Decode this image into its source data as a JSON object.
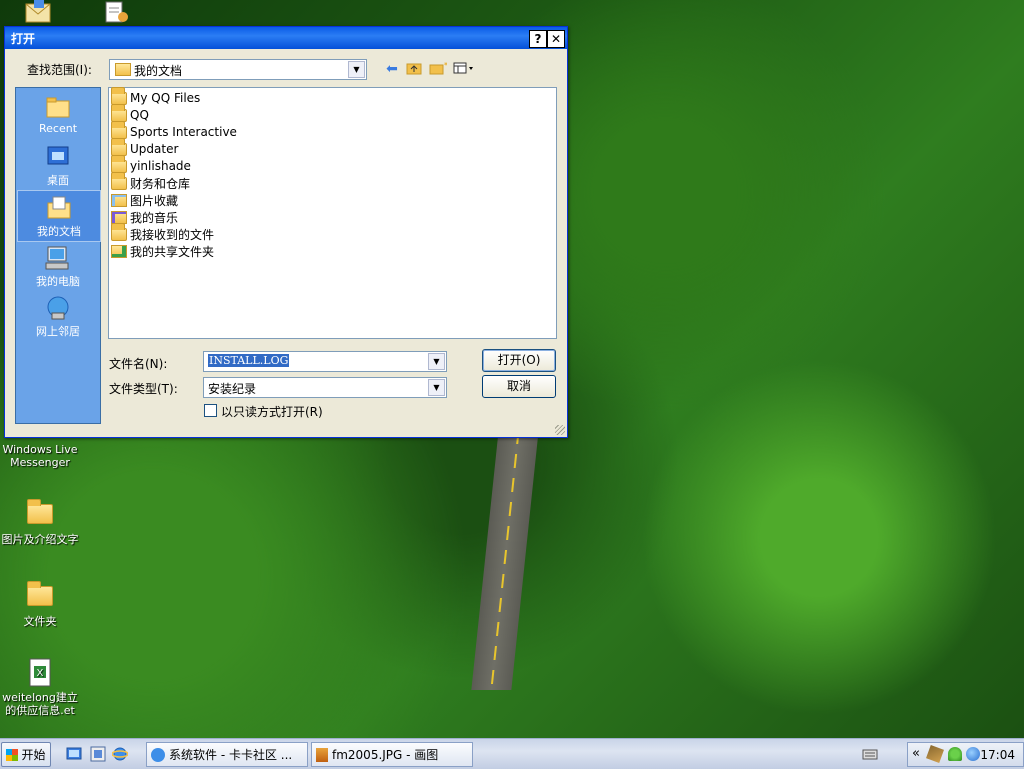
{
  "desktop": {
    "icons": [
      {
        "label": "Windows Live Messenger"
      },
      {
        "label": "图片及介绍文字"
      },
      {
        "label": "文件夹"
      },
      {
        "label": "weitelong建立的供应信息.et"
      }
    ]
  },
  "dialog": {
    "title": "打开",
    "help_button": "?",
    "close_button": "✕",
    "look_in_label": "查找范围(I):",
    "look_in_value": "我的文档",
    "places": [
      {
        "label": "Recent"
      },
      {
        "label": "桌面"
      },
      {
        "label": "我的文档"
      },
      {
        "label": "我的电脑"
      },
      {
        "label": "网上邻居"
      }
    ],
    "files": [
      {
        "name": "My QQ Files"
      },
      {
        "name": "QQ"
      },
      {
        "name": "Sports Interactive"
      },
      {
        "name": "Updater"
      },
      {
        "name": "yinlishade"
      },
      {
        "name": "财务和仓库"
      },
      {
        "name": "图片收藏"
      },
      {
        "name": "我的音乐"
      },
      {
        "name": "我接收到的文件"
      },
      {
        "name": "我的共享文件夹"
      }
    ],
    "filename_label": "文件名(N):",
    "filename_value": "INSTALL.LOG",
    "filetype_label": "文件类型(T):",
    "filetype_value": "安装纪录",
    "readonly_label": "以只读方式打开(R)",
    "open_button": "打开(O)",
    "cancel_button": "取消"
  },
  "taskbar": {
    "start_label": "开始",
    "tasks": [
      {
        "label": "系统软件 - 卡卡社区 ..."
      },
      {
        "label": "fm2005.JPG - 画图"
      }
    ],
    "tray_chevron": "«",
    "clock": "17:04"
  }
}
